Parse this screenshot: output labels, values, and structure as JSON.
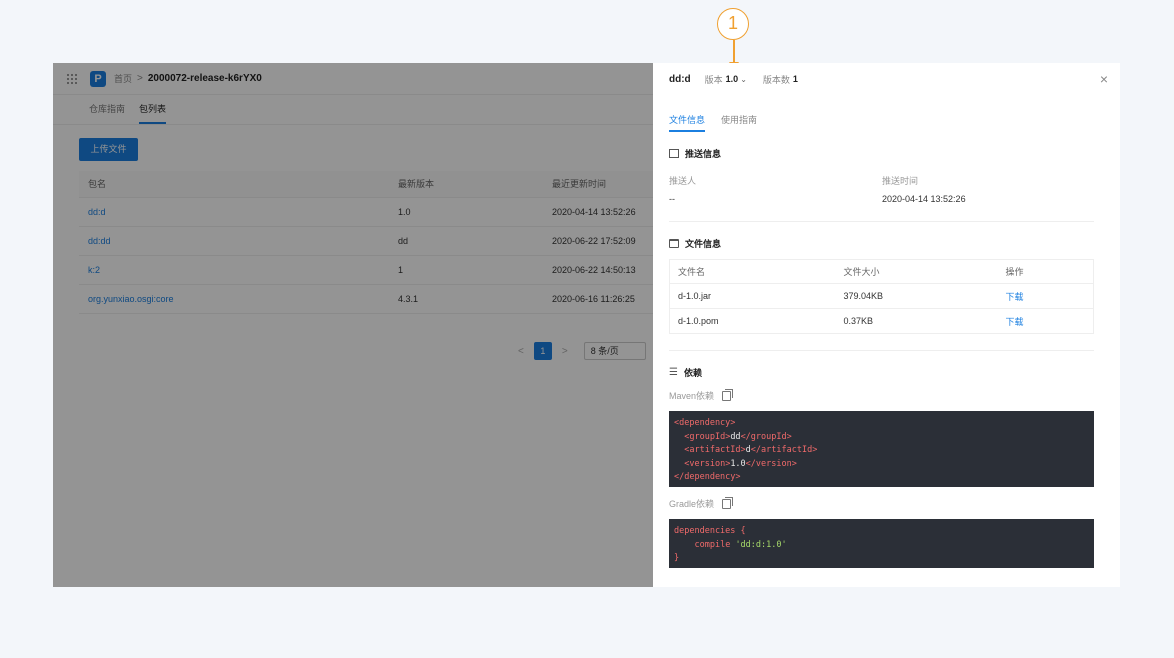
{
  "callout": {
    "number": "1"
  },
  "breadcrumb": {
    "home": "首页",
    "separator": ">",
    "current": "2000072-release-k6rYX0"
  },
  "subtabs": [
    {
      "label": "仓库指南"
    },
    {
      "label": "包列表"
    }
  ],
  "upload_button": "上传文件",
  "packages": {
    "columns": [
      "包名",
      "最新版本",
      "最近更新时间"
    ],
    "rows": [
      {
        "name": "dd:d",
        "version": "1.0",
        "updated": "2020-04-14 13:52:26"
      },
      {
        "name": "dd:dd",
        "version": "dd",
        "updated": "2020-06-22 17:52:09"
      },
      {
        "name": "k:2",
        "version": "1",
        "updated": "2020-06-22 14:50:13"
      },
      {
        "name": "org.yunxiao.osgi:core",
        "version": "4.3.1",
        "updated": "2020-06-16 11:26:25"
      }
    ]
  },
  "pagination": {
    "prev": "<",
    "current": "1",
    "next": ">",
    "page_size": "8 条/页"
  },
  "drawer": {
    "title": "dd:d",
    "version_label": "版本",
    "version_value": "1.0",
    "version_count_label": "版本数",
    "version_count_value": "1",
    "close": "×",
    "tabs": [
      {
        "label": "文件信息"
      },
      {
        "label": "使用指南"
      }
    ],
    "push_section": {
      "title": "推送信息",
      "pusher_label": "推送人",
      "pusher_value": "--",
      "time_label": "推送时间",
      "time_value": "2020-04-14 13:52:26"
    },
    "file_section": {
      "title": "文件信息",
      "columns": [
        "文件名",
        "文件大小",
        "操作"
      ],
      "rows": [
        {
          "name": "d-1.0.jar",
          "size": "379.04KB",
          "action": "下载"
        },
        {
          "name": "d-1.0.pom",
          "size": "0.37KB",
          "action": "下载"
        }
      ]
    },
    "dependency_section": {
      "title": "依赖",
      "maven_label": "Maven依赖",
      "gradle_label": "Gradle依赖",
      "maven_code": {
        "open_dependency": "<dependency>",
        "group": {
          "open": "<groupId>",
          "value": "dd",
          "close": "</groupId>"
        },
        "artifact": {
          "open": "<artifactId>",
          "value": "d",
          "close": "</artifactId>"
        },
        "version": {
          "open": "<version>",
          "value": "1.0",
          "close": "</version>"
        },
        "close_dependency": "</dependency>"
      },
      "gradle_code": {
        "open": "dependencies {",
        "keyword": "compile",
        "string": "'dd:d:1.0'",
        "close": "}"
      }
    }
  },
  "colors": {
    "accent": "#1b7fe0",
    "callout": "#f0a030",
    "code_bg": "#2b2f37"
  }
}
